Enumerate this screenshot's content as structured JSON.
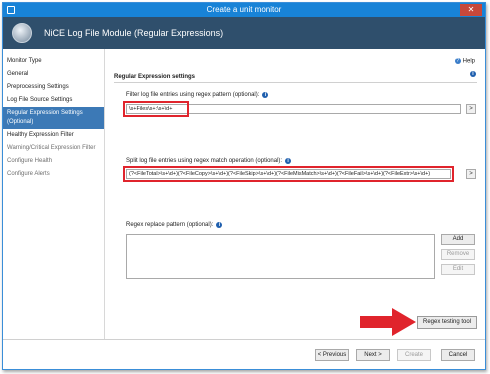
{
  "window": {
    "title": "Create a unit monitor",
    "close_glyph": "✕"
  },
  "header": {
    "module_title": "NiCE Log File Module (Regular Expressions)"
  },
  "sidebar": {
    "items": [
      {
        "label": "Monitor Type",
        "state": "normal"
      },
      {
        "label": "General",
        "state": "normal"
      },
      {
        "label": "Preprocessing Settings",
        "state": "normal"
      },
      {
        "label": "Log File Source Settings",
        "state": "normal"
      },
      {
        "label": "Regular Expression Settings (Optional)",
        "state": "active"
      },
      {
        "label": "Healthy Expression Filter",
        "state": "normal"
      },
      {
        "label": "Warning/Critical Expression Filter",
        "state": "disabled"
      },
      {
        "label": "Configure Health",
        "state": "disabled"
      },
      {
        "label": "Configure Alerts",
        "state": "disabled"
      }
    ]
  },
  "main": {
    "help_label": "Help",
    "section_title": "Regular Expression settings",
    "filter": {
      "label": "Filter log file entries using regex pattern (optional):",
      "value": "\\s+Files\\s+:\\s+\\d+"
    },
    "split": {
      "label": "Split log file entries using regex match operation (optional):",
      "value": "(?<FileTotal>\\s+\\d+)(?<FileCopy>\\s+\\d+)(?<FileSkip>\\s+\\d+)(?<FileMisMatch>\\s+\\d+)(?<FileFail>\\s+\\d+)(?<FileExtr>\\s+\\d+)"
    },
    "replace": {
      "label": "Regex replace pattern (optional):"
    },
    "buttons": {
      "add": "Add",
      "remove": "Remove",
      "edit": "Edit",
      "regex_tool": "Regex testing tool",
      "arrow": ">"
    }
  },
  "footer": {
    "previous": "< Previous",
    "next": "Next >",
    "create": "Create",
    "cancel": "Cancel"
  },
  "colors": {
    "titlebar": "#1883d7",
    "header": "#2f4f6c",
    "nav_active": "#3c79b6",
    "highlight": "#e0242c"
  }
}
